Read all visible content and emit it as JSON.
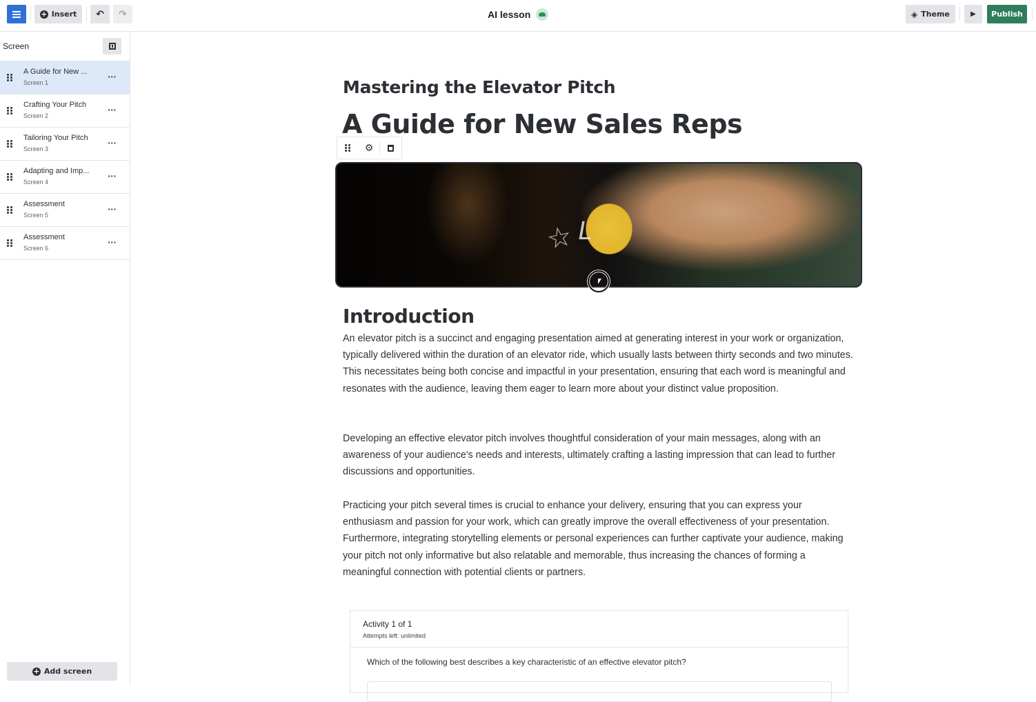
{
  "topbar": {
    "insert_label": "Insert",
    "doc_title": "AI lesson",
    "theme_label": "Theme",
    "publish_label": "Publish",
    "icons": {
      "menu": "hamburger-icon",
      "insert": "plus-circle-icon",
      "undo": "undo-icon",
      "redo": "redo-icon",
      "save_status": "cloud-check-icon",
      "theme": "paint-bucket-icon",
      "preview": "play-icon"
    },
    "colors": {
      "menu": "#2f6fd8",
      "publish": "#2f7d5b",
      "saved": "#2e8b57"
    }
  },
  "sidebar": {
    "title": "Screen",
    "items": [
      {
        "label": "A Guide for New ...",
        "sub": "Screen 1",
        "active": true
      },
      {
        "label": "Crafting Your Pitch",
        "sub": "Screen 2",
        "active": false
      },
      {
        "label": "Tailoring Your Pitch",
        "sub": "Screen 3",
        "active": false
      },
      {
        "label": "Adapting and Imp...",
        "sub": "Screen 4",
        "active": false
      },
      {
        "label": "Assessment",
        "sub": "Screen 5",
        "active": false
      },
      {
        "label": "Assessment",
        "sub": "Screen 6",
        "active": false
      }
    ],
    "add_screen_label": "Add screen"
  },
  "content": {
    "subtitle": "Mastering the Elevator Pitch",
    "title": "A Guide for New Sales Reps",
    "image_alt": "Hand pressing an elevator button",
    "section_title": "Introduction",
    "paragraphs": [
      "An elevator pitch is a succinct and engaging presentation aimed at generating interest in your work or organization, typically delivered within the duration of an elevator ride, which usually lasts between thirty seconds and two minutes. This necessitates being both concise and impactful in your presentation, ensuring that each word is meaningful and resonates with the audience, leaving them eager to learn more about your distinct value proposition.",
      "Developing an effective elevator pitch involves thoughtful consideration of your main messages, along with an awareness of your audience's needs and interests, ultimately crafting a lasting impression that can lead to further discussions and opportunities.",
      "Practicing your pitch several times is crucial to enhance your delivery, ensuring that you can express your enthusiasm and passion for your work, which can greatly improve the overall effectiveness of your presentation. Furthermore, integrating storytelling elements or personal experiences can further captivate your audience, making your pitch not only informative but also relatable and memorable, thus increasing the chances of forming a meaningful connection with potential clients or partners."
    ],
    "activity": {
      "title": "Activity 1 of 1",
      "attempts": "Attempts left: unlimited",
      "question": "Which of the following best describes a key characteristic of an effective elevator pitch?"
    }
  }
}
